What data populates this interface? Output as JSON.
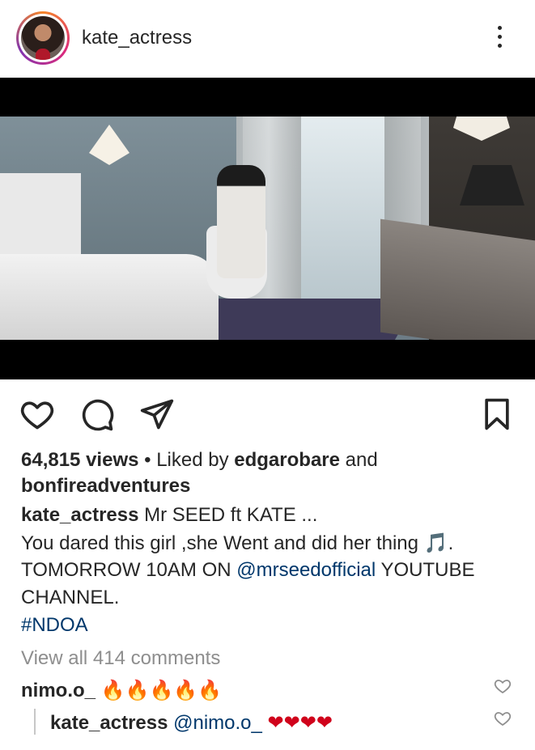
{
  "post": {
    "username": "kate_actress",
    "views": "64,815 views",
    "liked_by_prefix": "Liked by",
    "liked_by_user1": "edgarobare",
    "liked_by_and": "and",
    "liked_by_user2": "bonfireadventures",
    "caption_user": "kate_actress",
    "caption_line1": "Mr SEED ft KATE ...",
    "caption_line2_text": "You dared this girl ,she Went and did her thing",
    "caption_line2_emoji": "🎵",
    "caption_line2_end": ".",
    "caption_line3_a": "TOMORROW 10AM ON",
    "caption_line3_mention": "@mrseedofficial",
    "caption_line3_b": "YOUTUBE",
    "caption_line4": "CHANNEL.",
    "hashtag": "#NDOA",
    "view_comments": "View all 414 comments"
  },
  "comments": [
    {
      "user": "nimo.o_",
      "text": "🔥🔥🔥🔥🔥"
    },
    {
      "user": "kate_actress",
      "mention": "@nimo.o_",
      "text": "❤❤❤❤"
    }
  ],
  "icons": {
    "more": "more-vertical-icon",
    "like": "heart-icon",
    "comment": "comment-icon",
    "share": "send-icon",
    "save": "bookmark-icon"
  },
  "colors": {
    "text": "#262626",
    "link": "#00376b",
    "muted": "#8e8e8e"
  }
}
